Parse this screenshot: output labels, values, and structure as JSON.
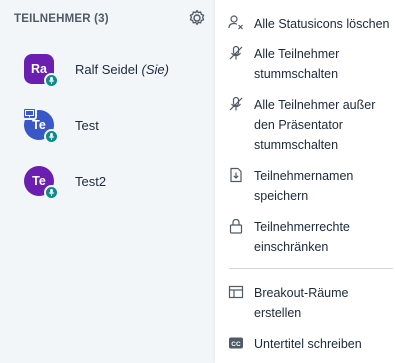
{
  "participants_panel": {
    "header": "TEILNEHMER (3)",
    "gear_icon": "gear-icon",
    "users": [
      {
        "initials": "Ra",
        "name": "Ralf Seidel",
        "suffix": "(Sie)",
        "avatar_color": "#6b1fb1"
      },
      {
        "initials": "Te",
        "name": "Test",
        "suffix": "",
        "avatar_color": "#3a57c9",
        "presenter": true
      },
      {
        "initials": "Te",
        "name": "Test2",
        "suffix": "",
        "avatar_color": "#6b1fb1"
      }
    ]
  },
  "options_menu": {
    "items": [
      {
        "label": "Alle Statusicons löschen",
        "icon": "clear-status-icon"
      },
      {
        "label": "Alle Teilnehmer stummschalten",
        "icon": "mute-icon"
      },
      {
        "label": "Alle Teilnehmer außer den Präsentator stummschalten",
        "icon": "mute-icon"
      },
      {
        "label": "Teilnehmernamen speichern",
        "icon": "download-file-icon"
      },
      {
        "label": "Teilnehmerrechte einschränken",
        "icon": "lock-icon"
      },
      {
        "label": "Breakout-Räume erstellen",
        "icon": "rooms-icon"
      },
      {
        "label": "Untertitel schreiben",
        "icon": "closed-captions-icon"
      }
    ]
  },
  "colors": {
    "accent": "#0d8a8a",
    "panel_bg": "#f3f6f9"
  }
}
